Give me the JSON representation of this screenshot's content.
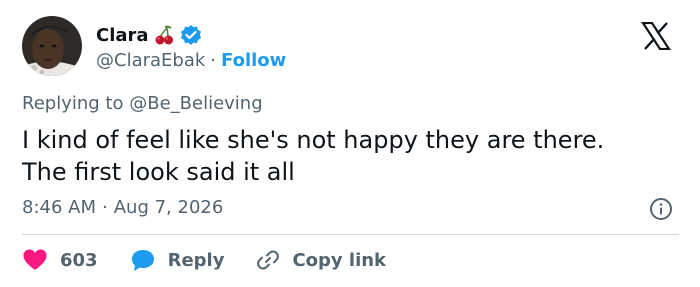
{
  "user": {
    "display_name": "Clara",
    "handle": "@ClaraEbak",
    "separator": "·",
    "follow_label": "Follow"
  },
  "tweet": {
    "replying_prefix": "Replying to",
    "replying_to": "@Be_Believing",
    "text_line1": "I kind of feel like she's not happy they are there.",
    "text_line2": "The first look said it all",
    "time": "8:46 AM",
    "date_separator": "·",
    "date": "Aug 7, 2026"
  },
  "actions": {
    "like_count": "603",
    "reply_label": "Reply",
    "copy_label": "Copy link"
  },
  "colors": {
    "like": "#f91880",
    "reply": "#1d9bf0",
    "verified": "#1d9bf0",
    "link": "#1d9bf0",
    "muted": "#536471"
  },
  "icons": [
    "cherry-icon",
    "verified-icon",
    "x-logo-icon",
    "info-icon",
    "heart-icon",
    "reply-bubble-icon",
    "link-icon"
  ]
}
